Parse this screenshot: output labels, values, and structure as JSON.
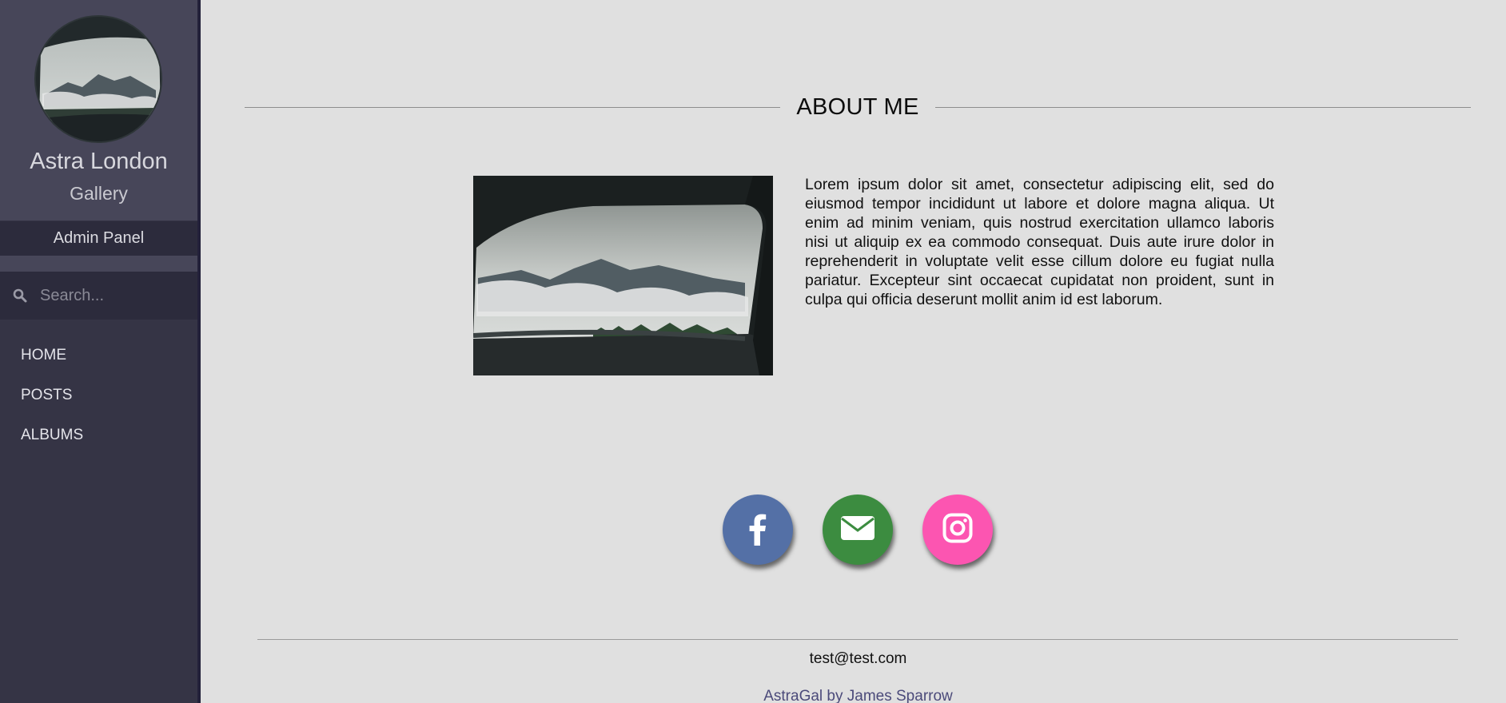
{
  "sidebar": {
    "title": "Astra London",
    "subtitle": "Gallery",
    "admin_label": "Admin Panel",
    "search": {
      "placeholder": "Search...",
      "value": ""
    },
    "nav": [
      {
        "label": "HOME"
      },
      {
        "label": "POSTS"
      },
      {
        "label": "ALBUMS"
      }
    ]
  },
  "main": {
    "section_title": "ABOUT ME",
    "about_text": "Lorem ipsum dolor sit amet, consectetur adipiscing elit, sed do eiusmod tempor incididunt ut labore et dolore magna aliqua. Ut enim ad minim veniam, quis nostrud exercitation ullamco laboris nisi ut aliquip ex ea commodo consequat. Duis aute irure dolor in reprehenderit in voluptate velit esse cillum dolore eu fugiat nulla pariatur. Excepteur sint occaecat cupidatat non proident, sunt in culpa qui officia deserunt mollit anim id est laborum.",
    "social": [
      {
        "icon": "facebook-icon",
        "color": "#5470a6"
      },
      {
        "icon": "email-icon",
        "color": "#3c8c40"
      },
      {
        "icon": "instagram-icon",
        "color": "#fc55b1"
      }
    ]
  },
  "footer": {
    "email": "test@test.com",
    "credit": "AstraGal by James Sparrow"
  },
  "colors": {
    "background": "#e0e0e0",
    "sidebar": "#353445",
    "sidebar_header": "#474659",
    "accent_credit": "#4b4a7a"
  }
}
